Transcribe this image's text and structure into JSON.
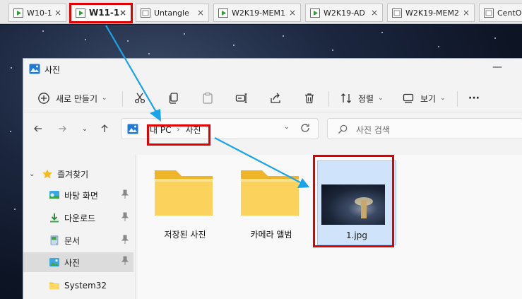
{
  "vm_tabs": [
    {
      "label": "W10-1",
      "active": false
    },
    {
      "label": "W11-1",
      "active": true
    },
    {
      "label": "Untangle",
      "active": false
    },
    {
      "label": "W2K19-MEM1",
      "active": false
    },
    {
      "label": "W2K19-AD",
      "active": false
    },
    {
      "label": "W2K19-MEM2",
      "active": false
    },
    {
      "label": "CentOS",
      "active": false
    }
  ],
  "tab_close_glyph": "×",
  "window": {
    "title": "사진",
    "minimize_glyph": "—"
  },
  "command_bar": {
    "new_label": "새로 만들기",
    "sort_label": "정렬",
    "view_label": "보기",
    "more_glyph": "···",
    "icons": [
      "plus-circle-icon",
      "cut-icon",
      "copy-icon",
      "paste-icon",
      "rename-icon",
      "share-icon",
      "delete-icon",
      "sort-icon",
      "view-icon"
    ]
  },
  "address": {
    "crumbs": [
      "내 PC",
      "사진"
    ],
    "separator": "›"
  },
  "search": {
    "placeholder": "사진 검색"
  },
  "nav_pane": {
    "favorites_label": "즐겨찾기",
    "items": [
      {
        "label": "바탕 화면",
        "icon": "desktop-icon",
        "pinned": true
      },
      {
        "label": "다운로드",
        "icon": "download-icon",
        "pinned": true
      },
      {
        "label": "문서",
        "icon": "documents-icon",
        "pinned": true
      },
      {
        "label": "사진",
        "icon": "pictures-icon",
        "pinned": true,
        "selected": true
      },
      {
        "label": "System32",
        "icon": "folder-icon",
        "pinned": false
      }
    ]
  },
  "content": {
    "items": [
      {
        "label": "저장된 사진",
        "type": "folder"
      },
      {
        "label": "카메라 앨범",
        "type": "folder"
      },
      {
        "label": "1.jpg",
        "type": "image",
        "selected": true
      }
    ]
  },
  "colors": {
    "highlight_red": "#e00000",
    "arrow_blue": "#1aa3e8",
    "selection_blue": "#cfe4fa",
    "folder_yellow": "#f8c93e"
  }
}
